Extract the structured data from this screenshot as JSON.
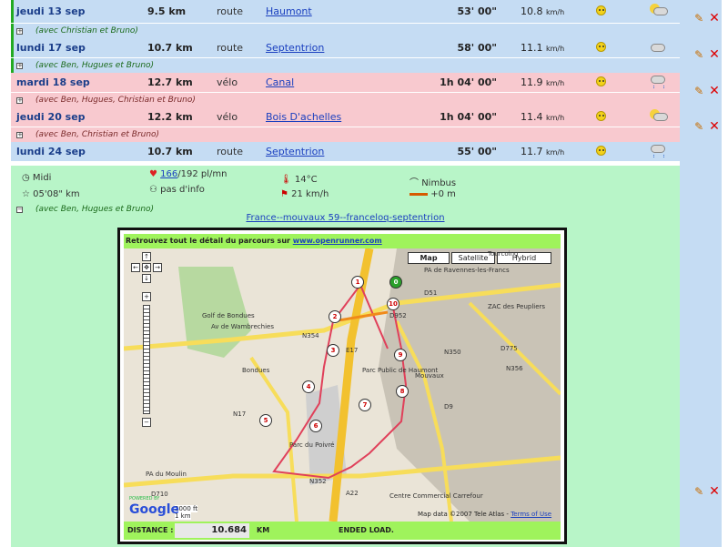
{
  "rows": [
    {
      "date": "jeudi 13 sep",
      "distance": "9.5 km",
      "type": "route",
      "location": "Haumont",
      "time": "53' 00\"",
      "speed": "10.8",
      "unit": "km/h",
      "weather": "sun-cloud-icon",
      "companions": "(avec Christian et Bruno)"
    },
    {
      "date": "lundi 17 sep",
      "distance": "10.7 km",
      "type": "route",
      "location": "Septentrion",
      "time": "58' 00\"",
      "speed": "11.1",
      "unit": "km/h",
      "weather": "cloud-icon",
      "companions": "(avec Ben, Hugues et Bruno)"
    },
    {
      "date": "mardi 18 sep",
      "distance": "12.7 km",
      "type": "vélo",
      "location": "Canal",
      "time": "1h 04' 00\"",
      "speed": "11.9",
      "unit": "km/h",
      "weather": "rain-icon",
      "companions": "(avec Ben, Hugues, Christian et Bruno)"
    },
    {
      "date": "jeudi 20 sep",
      "distance": "12.2 km",
      "type": "vélo",
      "location": "Bois D'achelles",
      "time": "1h 04' 00\"",
      "speed": "11.4",
      "unit": "km/h",
      "weather": "sun-cloud-icon",
      "companions": "(avec Ben, Christian et Bruno)"
    },
    {
      "date": "lundi 24 sep",
      "distance": "10.7 km",
      "type": "route",
      "location": "Septentrion",
      "time": "55' 00\"",
      "speed": "11.7",
      "unit": "km/h",
      "weather": "rain-icon",
      "companions": "(avec Ben, Hugues et Bruno)"
    }
  ],
  "detail": {
    "time_of_day": "Midi",
    "pace": "05'08\" km",
    "heart_link": "166",
    "heart_rest": "/192 pl/mn",
    "info": "pas d'info",
    "temperature": "14°C",
    "wind": "21 km/h",
    "sky": "Nimbus",
    "elevation": "+0 m",
    "map_link": "France--mouvaux 59--franceloq-septentrion"
  },
  "map": {
    "header_text": "Retrouvez tout le détail du parcours sur",
    "header_link": "www.openrunner.com",
    "types": [
      "Map",
      "Satellite",
      "Hybrid"
    ],
    "distance_label": "DISTANCE :",
    "distance_value": "10.684",
    "distance_unit": "KM",
    "status": "ENDED LOAD.",
    "scale_ft": "2000 ft",
    "scale_km": "1 km",
    "copyright": "Map data ©2007 Tele Atlas -",
    "terms": "Terms of Use",
    "google": "Google",
    "powered": "POWERED BY",
    "places": [
      "Tourcoing",
      "PA de Ravennes-les-Francs",
      "D51",
      "ZAC des Peupliers",
      "Golf de Bondues",
      "N354",
      "Av de Wambrechies",
      "Bondues",
      "Parc Public de Haumont",
      "Mouvaux",
      "N350",
      "D775",
      "N356",
      "D9",
      "N17",
      "Parc du Poivré",
      "PA du Moulin",
      "D710",
      "N352",
      "Centre Commercial Carrefour",
      "A22",
      "E17",
      "D952"
    ],
    "markers": [
      "0",
      "1",
      "10",
      "2",
      "3",
      "9",
      "4",
      "8",
      "7",
      "5",
      "6"
    ]
  },
  "colors": {
    "blue_row": "#c5dcf3",
    "pink_row": "#f8c9cf",
    "green_row": "#b8f5c8",
    "map_bar": "#9ff35c"
  }
}
